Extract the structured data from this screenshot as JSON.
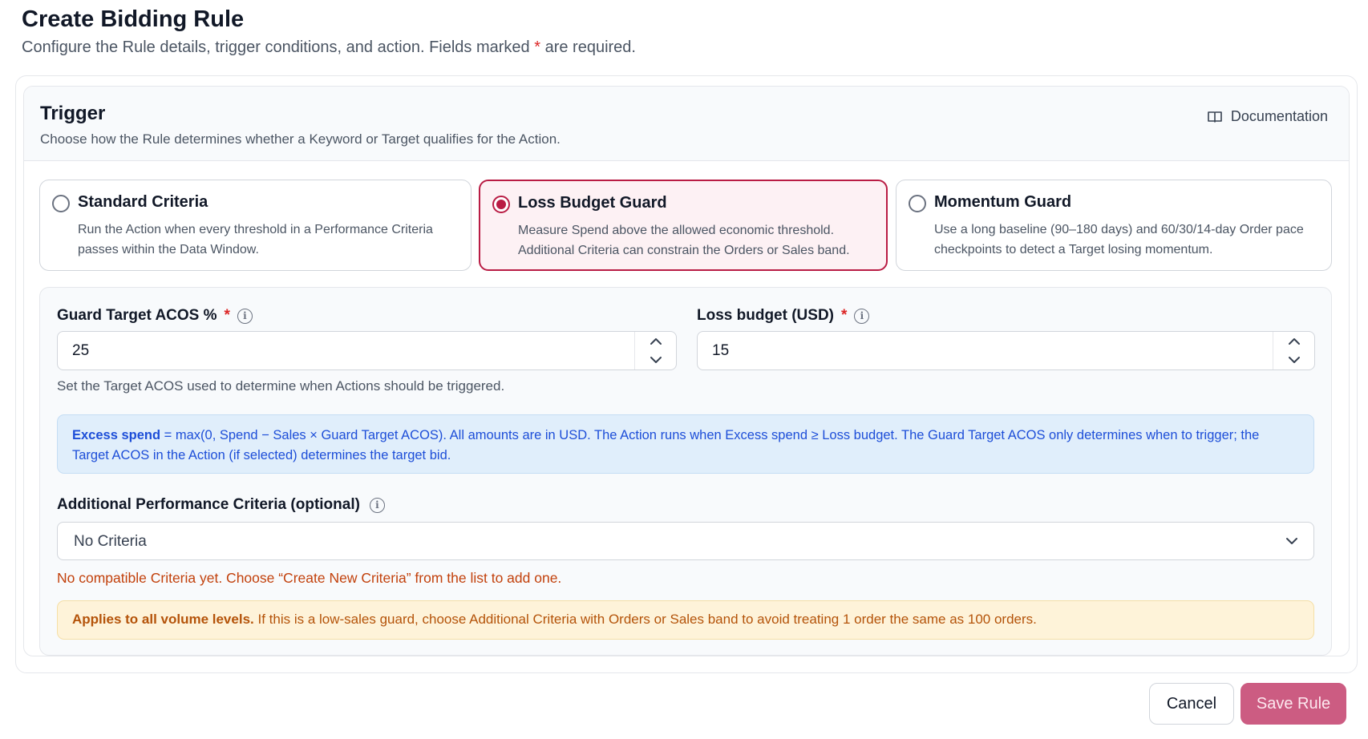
{
  "page": {
    "title": "Create Bidding Rule",
    "subtitle_before": "Configure the Rule details, trigger conditions, and action. Fields marked ",
    "required_marker": "*",
    "subtitle_after": " are required."
  },
  "trigger": {
    "title": "Trigger",
    "description": "Choose how the Rule determines whether a Keyword or Target qualifies for the Action.",
    "documentation_label": "Documentation",
    "options": [
      {
        "title": "Standard Criteria",
        "description": "Run the Action when every threshold in a Performance Criteria passes within the Data Window.",
        "selected": false
      },
      {
        "title": "Loss Budget Guard",
        "description": "Measure Spend above the allowed economic threshold. Additional Criteria can constrain the Orders or Sales band.",
        "selected": true
      },
      {
        "title": "Momentum Guard",
        "description": "Use a long baseline (90–180 days) and 60/30/14-day Order pace checkpoints to detect a Target losing momentum.",
        "selected": false
      }
    ]
  },
  "fields": {
    "guard_acos": {
      "label": "Guard Target ACOS %",
      "required": "*",
      "value": "25"
    },
    "loss_budget": {
      "label": "Loss budget (USD)",
      "required": "*",
      "value": "15"
    },
    "help_text": "Set the Target ACOS used to determine when Actions should be triggered."
  },
  "info_box": {
    "bold": "Excess spend",
    "text": " = max(0, Spend − Sales × Guard Target ACOS). All amounts are in USD. The Action runs when Excess spend ≥ Loss budget. The Guard Target ACOS only determines when to trigger; the Target ACOS in the Action (if selected) determines the target bid."
  },
  "criteria": {
    "label": "Additional Performance Criteria (optional)",
    "selected": "No Criteria",
    "warning": "No compatible Criteria yet. Choose “Create New Criteria” from the list to add one."
  },
  "note": {
    "bold": "Applies to all volume levels.",
    "text": " If this is a low-sales guard, choose Additional Criteria with Orders or Sales band to avoid treating 1 order the same as 100 orders."
  },
  "buttons": {
    "cancel": "Cancel",
    "save": "Save Rule"
  },
  "colors": {
    "accent": "#b91c44",
    "save_button": "#cc5c82",
    "info_text": "#1d4ed8",
    "warning_text": "#c2410c"
  }
}
